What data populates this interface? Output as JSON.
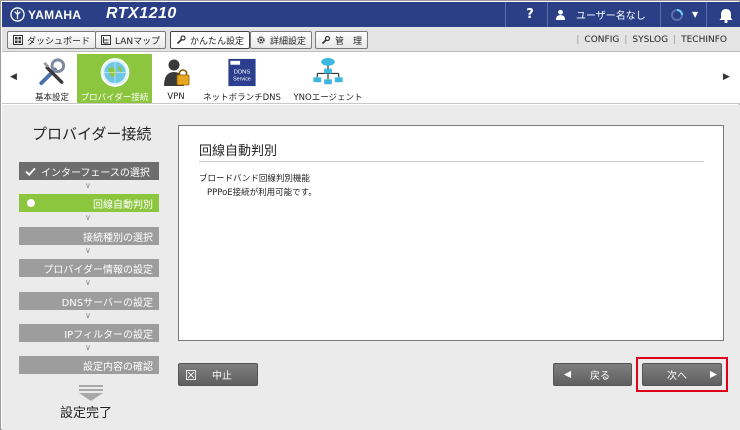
{
  "header": {
    "brand": "YAMAHA",
    "model": "RTX1210",
    "help": "?",
    "user": "ユーザー名なし"
  },
  "tabs": [
    {
      "label": "ダッシュボード"
    },
    {
      "label": "LANマップ"
    },
    {
      "label": "かんたん設定"
    },
    {
      "label": "詳細設定"
    },
    {
      "label": "管　理"
    }
  ],
  "top_links": [
    "CONFIG",
    "SYSLOG",
    "TECHINFO"
  ],
  "ribbon": {
    "items": [
      {
        "label": "基本設定"
      },
      {
        "label": "プロバイダー接続"
      },
      {
        "label": "VPN"
      },
      {
        "label": "ネットボランチDNS",
        "icon_text_1": "DDNS",
        "icon_text_2": "Service"
      },
      {
        "label": "YNOエージェント"
      }
    ]
  },
  "wizard": {
    "title": "プロバイダー接続",
    "steps": [
      {
        "label": "インターフェースの選択",
        "state": "done"
      },
      {
        "label": "回線自動判別",
        "state": "current"
      },
      {
        "label": "接続種別の選択",
        "state": "pending"
      },
      {
        "label": "プロバイダー情報の設定",
        "state": "pending"
      },
      {
        "label": "DNSサーバーの設定",
        "state": "pending"
      },
      {
        "label": "IPフィルターの設定",
        "state": "pending"
      },
      {
        "label": "設定内容の確認",
        "state": "pending"
      }
    ],
    "complete_label": "設定完了"
  },
  "panel": {
    "title": "回線自動判別",
    "label": "ブロードバンド回線判別機能",
    "value": "PPPoE接続が利用可能です。"
  },
  "buttons": {
    "cancel": "中止",
    "back": "戻る",
    "next": "次へ"
  },
  "colors": {
    "header_bg": "#2a3f86",
    "accent_green": "#8cc63e",
    "highlight_red": "#e0001b"
  }
}
